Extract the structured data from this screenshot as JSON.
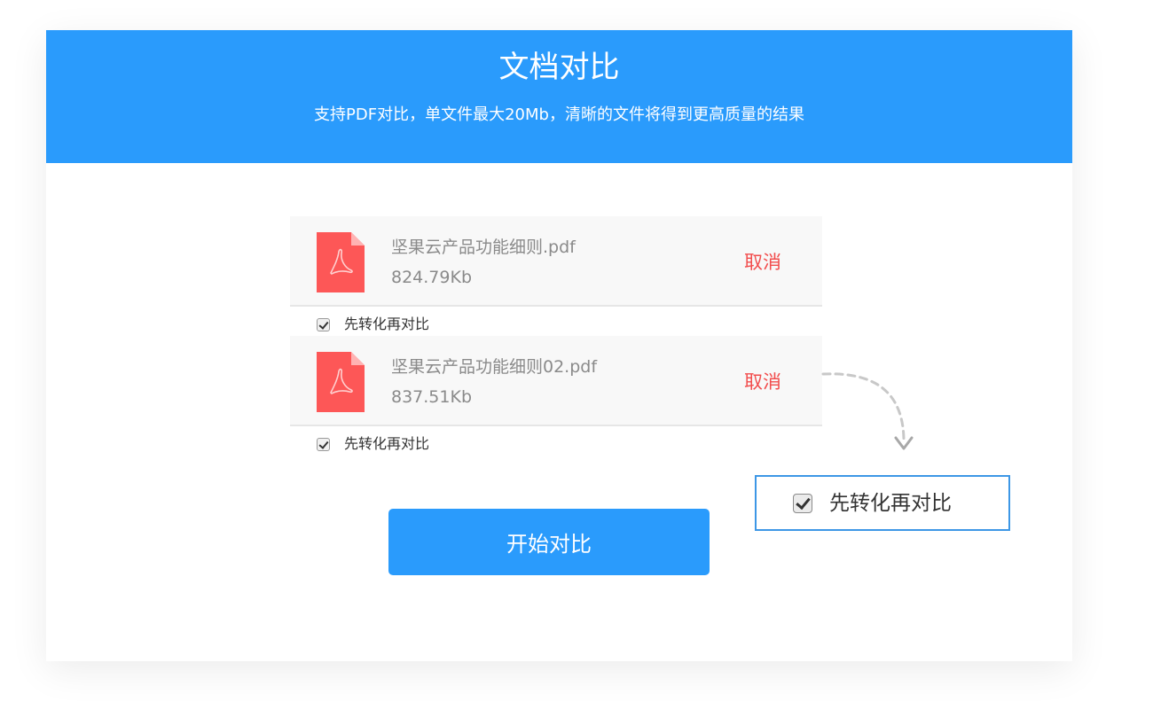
{
  "header": {
    "title": "文档对比",
    "subtitle": "支持PDF对比，单文件最大20Mb，清晰的文件将得到更高质量的结果"
  },
  "files": [
    {
      "name": "坚果云产品功能细则.pdf",
      "size": "824.79Kb",
      "cancel_label": "取消",
      "convert_label": "先转化再对比",
      "convert_checked": true,
      "icon": "pdf-file-icon"
    },
    {
      "name": "坚果云产品功能细则02.pdf",
      "size": "837.51Kb",
      "cancel_label": "取消",
      "convert_label": "先转化再对比",
      "convert_checked": true,
      "icon": "pdf-file-icon"
    }
  ],
  "start_button": {
    "label": "开始对比"
  },
  "callout": {
    "label": "先转化再对比",
    "checked": true
  },
  "colors": {
    "brand_blue": "#2a9bfc",
    "cancel_red": "#f24d4d",
    "pdf_red": "#fd5757",
    "callout_border": "#3d97e6"
  }
}
